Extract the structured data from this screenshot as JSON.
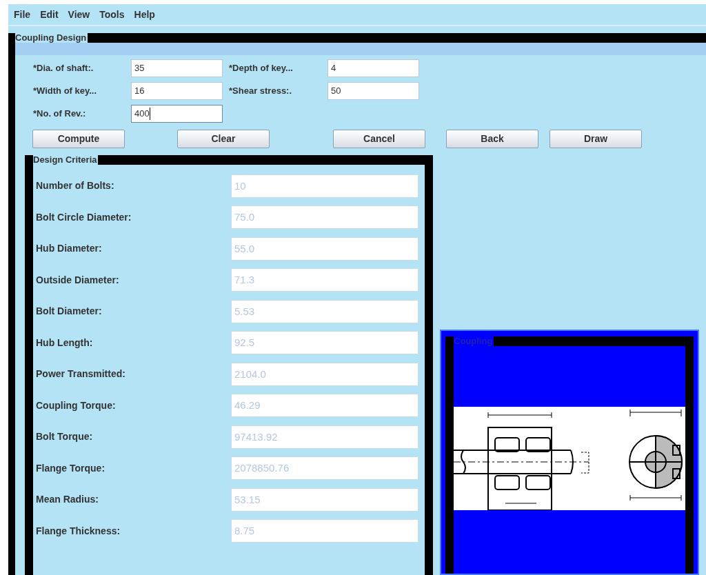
{
  "menu": [
    "File",
    "Edit",
    "View",
    "Tools",
    "Help"
  ],
  "window": {
    "title": "Coupling Design"
  },
  "inputs": [
    {
      "label": "*Dia. of shaft:.",
      "value": "35",
      "focused": false
    },
    {
      "label": "*Depth of key...",
      "value": "4",
      "focused": false
    },
    {
      "label": "*Width of key...",
      "value": "16",
      "focused": false
    },
    {
      "label": "*Shear stress:.",
      "value": "50",
      "focused": false
    },
    {
      "label": "*No. of Rev.:",
      "value": "400",
      "focused": true
    }
  ],
  "buttons": [
    "Compute",
    "Clear",
    "Cancel",
    "Back",
    "Draw"
  ],
  "criteria": {
    "title": "Design Criteria",
    "rows": [
      {
        "label": "Number of Bolts:",
        "value": "10",
        "disabled": true
      },
      {
        "label": "Bolt Circle Diameter:",
        "value": "75.0",
        "disabled": true
      },
      {
        "label": "Hub Diameter:",
        "value": "55.0",
        "disabled": true
      },
      {
        "label": "Outside Diameter:",
        "value": "71.3",
        "disabled": true
      },
      {
        "label": "Bolt Diameter:",
        "value": "5.53",
        "disabled": true
      },
      {
        "label": "Hub Length:",
        "value": "92.5",
        "disabled": true
      },
      {
        "label": "Power Transmitted:",
        "value": "2104.0",
        "disabled": true
      },
      {
        "label": "Coupling Torque:",
        "value": "46.29",
        "disabled": true
      },
      {
        "label": "Bolt Torque:",
        "value": "97413.92",
        "disabled": true
      },
      {
        "label": "Flange Torque:",
        "value": "2078850.76",
        "disabled": true
      },
      {
        "label": "Mean Radius:",
        "value": "53.15",
        "disabled": true
      },
      {
        "label": "Flange Thickness:",
        "value": "8.75",
        "disabled": true
      }
    ]
  },
  "coupling": {
    "title": "Coupling"
  }
}
